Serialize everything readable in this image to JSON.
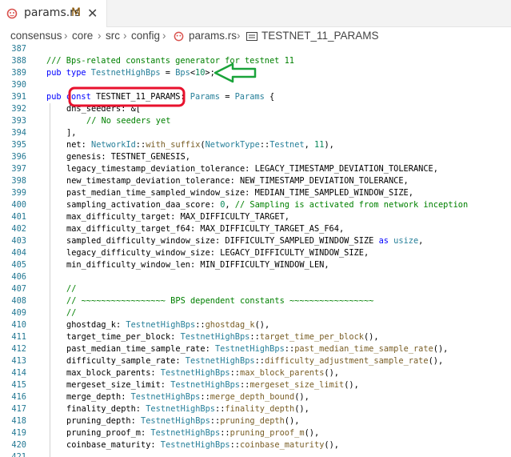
{
  "tab": {
    "filename": "params.rs",
    "modified": "M",
    "close": "✕"
  },
  "breadcrumb": [
    "consensus",
    "core",
    "src",
    "config",
    "params.rs",
    "TESTNET_11_PARAMS"
  ],
  "lines": [
    {
      "n": "387",
      "indent": 0,
      "tokens": []
    },
    {
      "n": "388",
      "indent": 0,
      "tokens": [
        [
          "c-comment",
          "/// Bps-related constants generator for testnet 11"
        ]
      ]
    },
    {
      "n": "389",
      "indent": 0,
      "tokens": [
        [
          "c-kw",
          "pub type "
        ],
        [
          "c-type",
          "TestnetHighBps"
        ],
        [
          "c-punc",
          " = "
        ],
        [
          "c-type",
          "Bps"
        ],
        [
          "c-punc",
          "<"
        ],
        [
          "c-num",
          "10"
        ],
        [
          "c-punc",
          ">;"
        ]
      ]
    },
    {
      "n": "390",
      "indent": 0,
      "tokens": []
    },
    {
      "n": "391",
      "indent": 0,
      "tokens": [
        [
          "c-kw",
          "pub const "
        ],
        [
          "c-punc",
          "TESTNET_11_PARAMS"
        ],
        [
          "c-punc",
          ": "
        ],
        [
          "c-type",
          "Params"
        ],
        [
          "c-punc",
          " = "
        ],
        [
          "c-type",
          "Params"
        ],
        [
          "c-punc",
          " {"
        ]
      ]
    },
    {
      "n": "392",
      "indent": 1,
      "tokens": [
        [
          "c-punc",
          "dns_seeders: &["
        ]
      ]
    },
    {
      "n": "393",
      "indent": 2,
      "tokens": [
        [
          "c-comment",
          "// No seeders yet"
        ]
      ]
    },
    {
      "n": "394",
      "indent": 1,
      "tokens": [
        [
          "c-punc",
          "],"
        ]
      ]
    },
    {
      "n": "395",
      "indent": 1,
      "tokens": [
        [
          "c-punc",
          "net: "
        ],
        [
          "c-type",
          "NetworkId"
        ],
        [
          "c-punc",
          "::"
        ],
        [
          "c-fn",
          "with_suffix"
        ],
        [
          "c-punc",
          "("
        ],
        [
          "c-type",
          "NetworkType"
        ],
        [
          "c-punc",
          "::"
        ],
        [
          "c-type",
          "Testnet"
        ],
        [
          "c-punc",
          ", "
        ],
        [
          "c-num",
          "11"
        ],
        [
          "c-punc",
          "),"
        ]
      ]
    },
    {
      "n": "396",
      "indent": 1,
      "tokens": [
        [
          "c-punc",
          "genesis: TESTNET_GENESIS,"
        ]
      ]
    },
    {
      "n": "397",
      "indent": 1,
      "tokens": [
        [
          "c-punc",
          "legacy_timestamp_deviation_tolerance: LEGACY_TIMESTAMP_DEVIATION_TOLERANCE,"
        ]
      ]
    },
    {
      "n": "398",
      "indent": 1,
      "tokens": [
        [
          "c-punc",
          "new_timestamp_deviation_tolerance: NEW_TIMESTAMP_DEVIATION_TOLERANCE,"
        ]
      ]
    },
    {
      "n": "399",
      "indent": 1,
      "tokens": [
        [
          "c-punc",
          "past_median_time_sampled_window_size: MEDIAN_TIME_SAMPLED_WINDOW_SIZE,"
        ]
      ]
    },
    {
      "n": "400",
      "indent": 1,
      "tokens": [
        [
          "c-punc",
          "sampling_activation_daa_score: "
        ],
        [
          "c-num",
          "0"
        ],
        [
          "c-punc",
          ", "
        ],
        [
          "c-comment",
          "// Sampling is activated from network inception"
        ]
      ]
    },
    {
      "n": "401",
      "indent": 1,
      "tokens": [
        [
          "c-punc",
          "max_difficulty_target: MAX_DIFFICULTY_TARGET,"
        ]
      ]
    },
    {
      "n": "402",
      "indent": 1,
      "tokens": [
        [
          "c-punc",
          "max_difficulty_target_f64: MAX_DIFFICULTY_TARGET_AS_F64,"
        ]
      ]
    },
    {
      "n": "403",
      "indent": 1,
      "tokens": [
        [
          "c-punc",
          "sampled_difficulty_window_size: DIFFICULTY_SAMPLED_WINDOW_SIZE "
        ],
        [
          "c-kw",
          "as "
        ],
        [
          "c-type",
          "usize"
        ],
        [
          "c-punc",
          ","
        ]
      ]
    },
    {
      "n": "404",
      "indent": 1,
      "tokens": [
        [
          "c-punc",
          "legacy_difficulty_window_size: LEGACY_DIFFICULTY_WINDOW_SIZE,"
        ]
      ]
    },
    {
      "n": "405",
      "indent": 1,
      "tokens": [
        [
          "c-punc",
          "min_difficulty_window_len: MIN_DIFFICULTY_WINDOW_LEN,"
        ]
      ]
    },
    {
      "n": "406",
      "indent": 0,
      "tokens": []
    },
    {
      "n": "407",
      "indent": 1,
      "tokens": [
        [
          "c-comment",
          "//"
        ]
      ]
    },
    {
      "n": "408",
      "indent": 1,
      "tokens": [
        [
          "c-comment",
          "// ~~~~~~~~~~~~~~~~~ BPS dependent constants ~~~~~~~~~~~~~~~~~"
        ]
      ]
    },
    {
      "n": "409",
      "indent": 1,
      "tokens": [
        [
          "c-comment",
          "//"
        ]
      ]
    },
    {
      "n": "410",
      "indent": 1,
      "tokens": [
        [
          "c-punc",
          "ghostdag_k: "
        ],
        [
          "c-type",
          "TestnetHighBps"
        ],
        [
          "c-punc",
          "::"
        ],
        [
          "c-fn",
          "ghostdag_k"
        ],
        [
          "c-punc",
          "(),"
        ]
      ]
    },
    {
      "n": "411",
      "indent": 1,
      "tokens": [
        [
          "c-punc",
          "target_time_per_block: "
        ],
        [
          "c-type",
          "TestnetHighBps"
        ],
        [
          "c-punc",
          "::"
        ],
        [
          "c-fn",
          "target_time_per_block"
        ],
        [
          "c-punc",
          "(),"
        ]
      ]
    },
    {
      "n": "412",
      "indent": 1,
      "tokens": [
        [
          "c-punc",
          "past_median_time_sample_rate: "
        ],
        [
          "c-type",
          "TestnetHighBps"
        ],
        [
          "c-punc",
          "::"
        ],
        [
          "c-fn",
          "past_median_time_sample_rate"
        ],
        [
          "c-punc",
          "(),"
        ]
      ]
    },
    {
      "n": "413",
      "indent": 1,
      "tokens": [
        [
          "c-punc",
          "difficulty_sample_rate: "
        ],
        [
          "c-type",
          "TestnetHighBps"
        ],
        [
          "c-punc",
          "::"
        ],
        [
          "c-fn",
          "difficulty_adjustment_sample_rate"
        ],
        [
          "c-punc",
          "(),"
        ]
      ]
    },
    {
      "n": "414",
      "indent": 1,
      "tokens": [
        [
          "c-punc",
          "max_block_parents: "
        ],
        [
          "c-type",
          "TestnetHighBps"
        ],
        [
          "c-punc",
          "::"
        ],
        [
          "c-fn",
          "max_block_parents"
        ],
        [
          "c-punc",
          "(),"
        ]
      ]
    },
    {
      "n": "415",
      "indent": 1,
      "tokens": [
        [
          "c-punc",
          "mergeset_size_limit: "
        ],
        [
          "c-type",
          "TestnetHighBps"
        ],
        [
          "c-punc",
          "::"
        ],
        [
          "c-fn",
          "mergeset_size_limit"
        ],
        [
          "c-punc",
          "(),"
        ]
      ]
    },
    {
      "n": "416",
      "indent": 1,
      "tokens": [
        [
          "c-punc",
          "merge_depth: "
        ],
        [
          "c-type",
          "TestnetHighBps"
        ],
        [
          "c-punc",
          "::"
        ],
        [
          "c-fn",
          "merge_depth_bound"
        ],
        [
          "c-punc",
          "(),"
        ]
      ]
    },
    {
      "n": "417",
      "indent": 1,
      "tokens": [
        [
          "c-punc",
          "finality_depth: "
        ],
        [
          "c-type",
          "TestnetHighBps"
        ],
        [
          "c-punc",
          "::"
        ],
        [
          "c-fn",
          "finality_depth"
        ],
        [
          "c-punc",
          "(),"
        ]
      ]
    },
    {
      "n": "418",
      "indent": 1,
      "tokens": [
        [
          "c-punc",
          "pruning_depth: "
        ],
        [
          "c-type",
          "TestnetHighBps"
        ],
        [
          "c-punc",
          "::"
        ],
        [
          "c-fn",
          "pruning_depth"
        ],
        [
          "c-punc",
          "(),"
        ]
      ]
    },
    {
      "n": "419",
      "indent": 1,
      "tokens": [
        [
          "c-punc",
          "pruning_proof_m: "
        ],
        [
          "c-type",
          "TestnetHighBps"
        ],
        [
          "c-punc",
          "::"
        ],
        [
          "c-fn",
          "pruning_proof_m"
        ],
        [
          "c-punc",
          "(),"
        ]
      ]
    },
    {
      "n": "420",
      "indent": 1,
      "tokens": [
        [
          "c-punc",
          "coinbase_maturity: "
        ],
        [
          "c-type",
          "TestnetHighBps"
        ],
        [
          "c-punc",
          "::"
        ],
        [
          "c-fn",
          "coinbase_maturity"
        ],
        [
          "c-punc",
          "(),"
        ]
      ]
    },
    {
      "n": "421",
      "indent": 0,
      "tokens": []
    }
  ],
  "colors": {
    "annotation_red": "#e8112d",
    "annotation_green": "#1aa33a",
    "rust_icon": "#d9534f"
  }
}
